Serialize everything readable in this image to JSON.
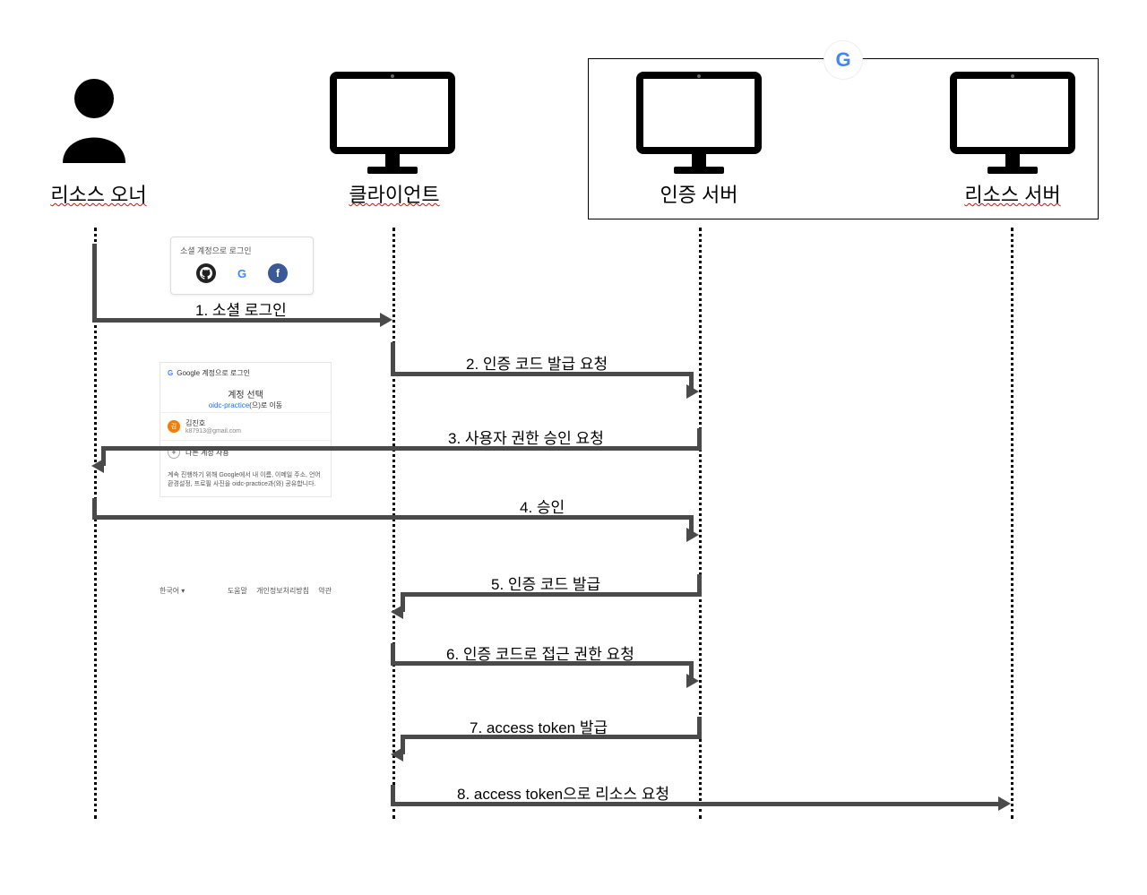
{
  "actors": {
    "owner": "리소스 오너",
    "client": "클라이언트",
    "auth_server": "인증 서버",
    "resource_server": "리소스 서버"
  },
  "steps": {
    "s1": "1. 소셜 로그인",
    "s2": "2. 인증 코드 발급 요청",
    "s3": "3. 사용자 권한 승인 요청",
    "s4": "4. 승인",
    "s5": "5. 인증 코드 발급",
    "s6": "6. 인증 코드로 접근 권한 요청",
    "s7": "7. access token 발급",
    "s8": "8. access token으로 리소스 요청"
  },
  "social_card": {
    "title": "소셜 계정으로 로그인"
  },
  "google_select": {
    "header": "Google 계정으로 로그인",
    "title": "계정 선택",
    "subtitle_prefix": "oidc-practice",
    "subtitle_suffix": "(으)로 이동",
    "user_name": "김진호",
    "user_email": "k87913@gmail.com",
    "other_account": "다른 계정 사용",
    "note": "계속 진행하기 위해 Google에서 내 이름, 이메일 주소, 언어 환경설정, 프로필 사진을 oidc-practice과(와) 공유합니다.",
    "lang": "한국어 ▾",
    "help": "도움말",
    "privacy": "개인정보처리방침",
    "terms": "약관"
  },
  "chart_data": {
    "type": "sequence_diagram",
    "actors": [
      "리소스 오너",
      "클라이언트",
      "인증 서버",
      "리소스 서버"
    ],
    "server_group": {
      "label": "Google",
      "members": [
        "인증 서버",
        "리소스 서버"
      ]
    },
    "messages": [
      {
        "n": 1,
        "from": "리소스 오너",
        "to": "클라이언트",
        "label": "소셜 로그인"
      },
      {
        "n": 2,
        "from": "클라이언트",
        "to": "인증 서버",
        "label": "인증 코드 발급 요청"
      },
      {
        "n": 3,
        "from": "인증 서버",
        "to": "리소스 오너",
        "label": "사용자 권한 승인 요청"
      },
      {
        "n": 4,
        "from": "리소스 오너",
        "to": "인증 서버",
        "label": "승인"
      },
      {
        "n": 5,
        "from": "인증 서버",
        "to": "클라이언트",
        "label": "인증 코드 발급"
      },
      {
        "n": 6,
        "from": "클라이언트",
        "to": "인증 서버",
        "label": "인증 코드로 접근 권한 요청"
      },
      {
        "n": 7,
        "from": "인증 서버",
        "to": "클라이언트",
        "label": "access token 발급"
      },
      {
        "n": 8,
        "from": "클라이언트",
        "to": "리소스 서버",
        "label": "access token으로 리소스 요청"
      }
    ]
  }
}
